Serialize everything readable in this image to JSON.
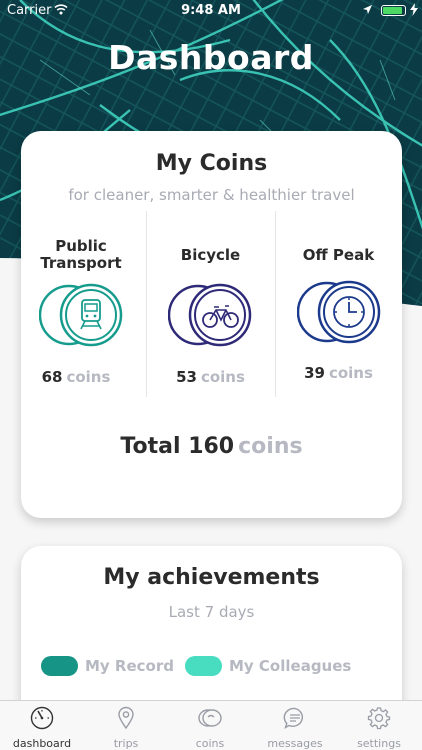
{
  "status_bar": {
    "carrier": "Carrier",
    "time": "9:48 AM",
    "battery_level": 0.9
  },
  "header": {
    "title": "Dashboard"
  },
  "coins_card": {
    "title": "My Coins",
    "subtitle": "for cleaner, smarter & healthier travel",
    "categories": [
      {
        "label": "Public Transport",
        "count": "68",
        "unit": "coins",
        "color": "#169c8d",
        "icon": "train-icon"
      },
      {
        "label": "Bicycle",
        "count": "53",
        "unit": "coins",
        "color": "#2f2a78",
        "icon": "bicycle-icon"
      },
      {
        "label": "Off Peak",
        "count": "39",
        "unit": "coins",
        "color": "#1c3a8c",
        "icon": "clock-icon"
      }
    ],
    "total_prefix": "Total",
    "total_value": "160",
    "total_unit": "coins"
  },
  "achievements_card": {
    "title": "My achievements",
    "subtitle": "Last 7 days",
    "legend": [
      {
        "label": "My Record",
        "color": "#169485"
      },
      {
        "label": "My Colleagues",
        "color": "#48dcc0"
      }
    ]
  },
  "tab_bar": {
    "active": "dashboard",
    "tabs": [
      {
        "label": "dashboard",
        "icon": "speedometer-icon"
      },
      {
        "label": "trips",
        "icon": "location-pin-icon"
      },
      {
        "label": "coins",
        "icon": "coin-icon"
      },
      {
        "label": "messages",
        "icon": "message-icon"
      },
      {
        "label": "settings",
        "icon": "gear-icon"
      }
    ]
  },
  "colors": {
    "hero_dark": "#0c3a45",
    "hero_vein": "#3fd1be",
    "accent": "#169c8d"
  }
}
